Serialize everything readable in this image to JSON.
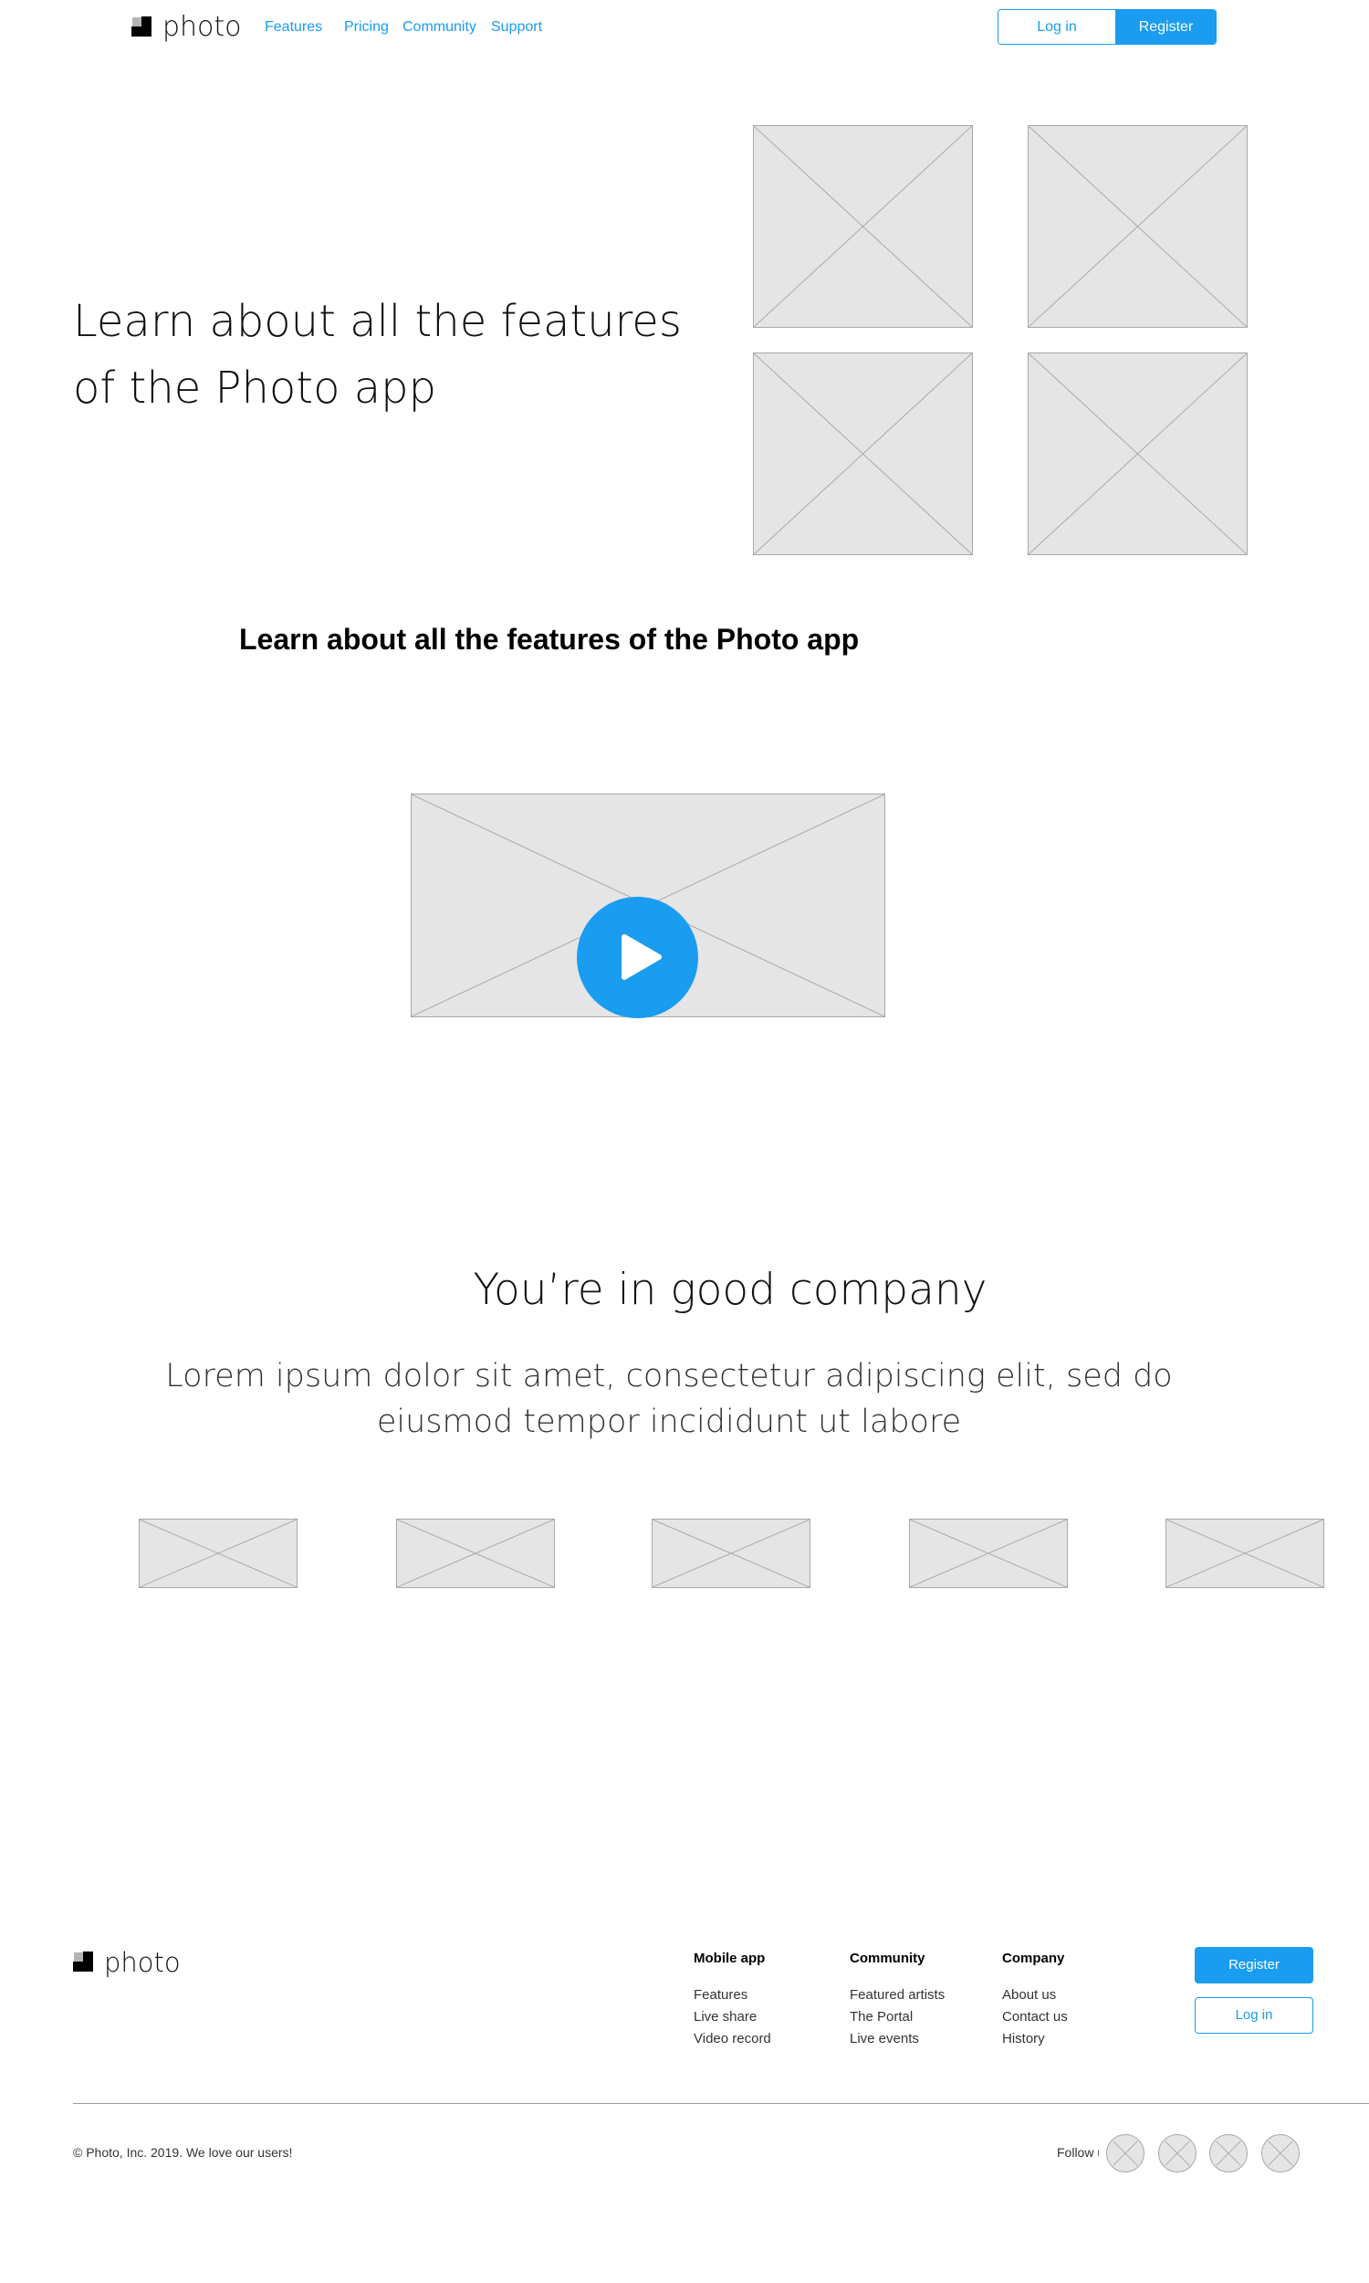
{
  "header": {
    "logo_text": "photo",
    "nav": [
      {
        "label": "Features"
      },
      {
        "label": "Pricing"
      },
      {
        "label": "Community"
      },
      {
        "label": "Support"
      }
    ],
    "login_label": "Log in",
    "register_label": "Register"
  },
  "hero": {
    "title_line1": "Learn about all the features",
    "title_line2": "of the Photo app"
  },
  "features": {
    "heading": "Learn about all the features of the Photo app"
  },
  "video": {
    "play_icon": "play-icon"
  },
  "company": {
    "title": "You’re in good company",
    "text_line1": "Lorem ipsum dolor sit amet, consectetur adipiscing elit, sed do",
    "text_line2": "eiusmod tempor incididunt ut labore"
  },
  "footer": {
    "logo_text": "photo",
    "columns": [
      {
        "heading": "Mobile app",
        "links": [
          "Features",
          "Live share",
          "Video record"
        ]
      },
      {
        "heading": "Community",
        "links": [
          "Featured artists",
          "The Portal",
          "Live events"
        ]
      },
      {
        "heading": "Company",
        "links": [
          "About us",
          "Contact us",
          "History"
        ]
      }
    ],
    "register_label": "Register",
    "login_label": "Log in",
    "copyright": "© Photo, Inc. 2019. We love our users!",
    "follow_label": "Follow us"
  },
  "colors": {
    "accent": "#1a9cf0",
    "placeholder_fill": "#e5e5e5",
    "placeholder_stroke": "#a9a9a9"
  }
}
